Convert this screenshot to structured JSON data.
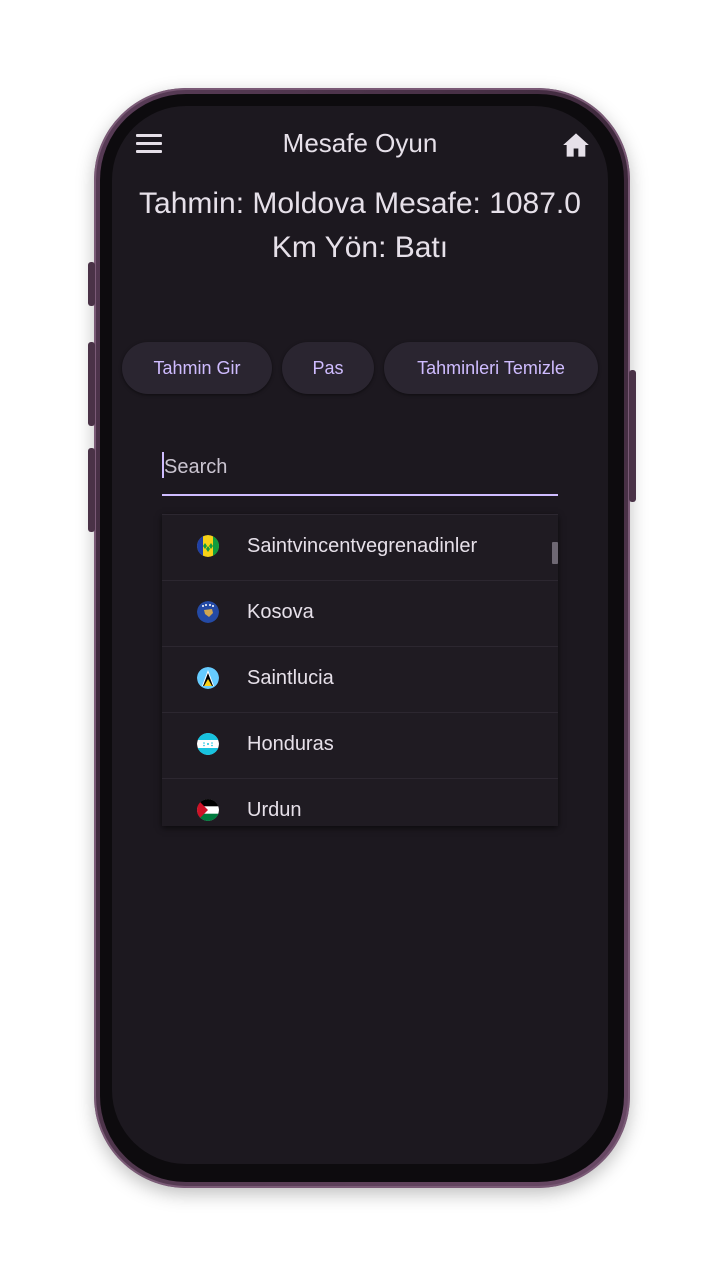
{
  "appbar": {
    "title": "Mesafe Oyun",
    "menu_icon": "menu-icon",
    "home_icon": "home-icon"
  },
  "result": {
    "line1": "Tahmin: Moldova    Mesafe: 1087.0",
    "line2": "Km   Yön: Batı"
  },
  "actions": {
    "guess_label": "Tahmin Gir",
    "pass_label": "Pas",
    "clear_label": "Tahminleri Temizle"
  },
  "search": {
    "placeholder": "Search",
    "value": ""
  },
  "dropdown": {
    "items": [
      {
        "label": "Saintvincentvegrenadinler",
        "flag_icon": "flag-saint-vincent-icon"
      },
      {
        "label": "Kosova",
        "flag_icon": "flag-kosovo-icon"
      },
      {
        "label": "Saintlucia",
        "flag_icon": "flag-saint-lucia-icon"
      },
      {
        "label": "Honduras",
        "flag_icon": "flag-honduras-icon"
      },
      {
        "label": "Urdun",
        "flag_icon": "flag-jordan-icon"
      }
    ]
  },
  "colors": {
    "background": "#1c181f",
    "text": "#e6e0e9",
    "accent": "#cfbcff",
    "pill": "#2a2530",
    "frame": "#5a3d58"
  }
}
